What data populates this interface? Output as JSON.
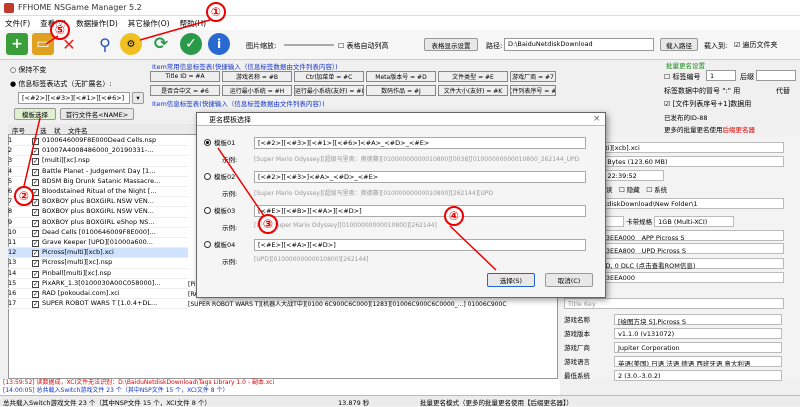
{
  "title": "FFHOME NSGame Manager 5.2",
  "menu": [
    "文件(F)",
    "查看(V)",
    "数据操作(D)",
    "其它操作(O)",
    "帮助(H)"
  ],
  "toolbar": {
    "thumb_label": "图片缩放:",
    "auto_table": "表格自动列高",
    "table_btn": "表格显示设置",
    "path_label": "路径:",
    "path_value": "D:\\BaiduNetdiskDownload",
    "load_path": "载入路径",
    "load_into": "载入到:",
    "filelist": "遍历文件夹"
  },
  "rename": {
    "keep": "保持不变",
    "template_label": "信息标签表达式（无扩展名）:",
    "template_value": "[<#2>][<#3>][<#1>][<#6>]",
    "template_btn": "模板选择",
    "first_file": "首行文件名<NAME>",
    "hint1": "Item常用信息标签表(快捷输入（信息标签数据由文件列表内容）)",
    "hint2": "Item信息标签表(快捷输入（信息标签数据由文件列表内容）)"
  },
  "tags": [
    "Title ID = #A",
    "游戏名称 = #B",
    "Ctrl加菜单 = #C",
    "Meta版本号 = #D",
    "文件类型 = #E",
    "游戏厂商 = #7",
    "是否合中文 = #6",
    "运行最小系统 = #H",
    "运行最小系统(友好) = #I",
    "数码作品 = #J",
    "文件大小(友好) = #K",
    "文件列表序号 = #L"
  ],
  "batch": {
    "title": "批量更名设置",
    "mark": "标签编号",
    "start": "1",
    "after": "后缀",
    "suffix_label": "标签数据中的冒号 \":\" 用",
    "suffix_val": "代替",
    "keep_sn": "[文件列表序号+1]数据用",
    "hint": "更名的修改文件名",
    "publish": "已发布的ID-88",
    "more": "更多的批量更名使用",
    "more_link": "后缀更名器"
  },
  "columns": [
    "序号",
    "选",
    "状",
    "文件名"
  ],
  "rows": [
    {
      "n": "1",
      "name": "0100646009F8E000Dead Cells.nsp",
      "r": ""
    },
    {
      "n": "2",
      "name": "01007A4008486000_20190331-...",
      "r": ""
    },
    {
      "n": "3",
      "name": "[multi][xc].nsp",
      "r": ""
    },
    {
      "n": "4",
      "name": "Battle Planet - Judgement Day [1...",
      "r": ""
    },
    {
      "n": "5",
      "name": "BDSM Big Drunk Satanic Massacre...",
      "r": ""
    },
    {
      "n": "6",
      "name": "Bloodstained Ritual of the Night [...",
      "r": ""
    },
    {
      "n": "7",
      "name": "BOXBOY plus BOXGIRL NSW VEN...",
      "r": ""
    },
    {
      "n": "8",
      "name": "BOXBOY plus BOXGIRL NSW VEN...",
      "r": ""
    },
    {
      "n": "9",
      "name": "BOXBOY plus BOXGIRL eShop NS...",
      "r": ""
    },
    {
      "n": "10",
      "name": "Dead Cells [0100646009F8E000]...",
      "r": ""
    },
    {
      "n": "11",
      "name": "Grave Keeper [UPD][01000a600...",
      "r": ""
    },
    {
      "n": "12",
      "name": "Picross[multi][xcb].xci",
      "r": ""
    },
    {
      "n": "13",
      "name": "Picross[multi][xc].nsp",
      "r": ""
    },
    {
      "n": "14",
      "name": "Pinball[multi][xc].nsp",
      "r": ""
    },
    {
      "n": "15",
      "name": "PixARK_1.3[0100030A00C058000]...",
      "r": "[PixARK][方块方舟][0100030A00C058000][1417][0100030A00C058000_65536_XCI].xci      010030A00C"
    },
    {
      "n": "16",
      "name": "RAD [pokoudai.com].xci",
      "r": "[RAD][无世突变][0100244005C16000][0][0100244000C516000_0_XCI].xci                 010024400C"
    },
    {
      "n": "17",
      "name": "SUPER ROBOT WARS T [1.0.4+DL...",
      "r": "[SUPER ROBOT WARS T][机器人大战T中][0100 6C900C6C000][1283][01006C900C6C0000_...]  01006C900C"
    }
  ],
  "info": {
    "name": "Picross[multi][xcb].xci",
    "size": "29,602,566 Bytes (123.60 MB)",
    "date": "2019/10/08 22:39:52",
    "attr_save": "存档",
    "attr_ro": "只读",
    "attr_hidden": "隐藏",
    "attr_sys": "系统",
    "path": "D:\\BaiduNetdiskDownload\\New Folder\\1",
    "type": "XCI",
    "card": "卡带规格",
    "card_val": "1GB (Multi-XCI)",
    "id1": "0100BA0003EEA000",
    "app1": "APP Picross S",
    "id2": "0100BA0003EEA800",
    "app2": "UPD Picross S",
    "count": "1 APP, 1 UPD, 0 DLC (点击查看ROM信息)",
    "tid": "0100BA0003EEA000",
    "title_key": "Title Key",
    "gname_label": "游戏名称",
    "gname": "[绘图方块 S].Picross S",
    "ver_label": "游戏版本",
    "ver": "v1.1.0 (v131072)",
    "maker_label": "游戏厂商",
    "maker": "Jupiter Corporation",
    "lang_label": "游戏语言",
    "lang": "英语(美国) 日语 法语 德语 西班牙语 意大利语",
    "sys_label": "最低系统",
    "sys": "2 (3.0.-3.0.2)"
  },
  "dialog": {
    "title": "更名模板选择",
    "templates": [
      {
        "label": "模板01",
        "value": "[<#2>][<#3>][<#1>][<#6>]<#A>_<#D>_<#E>",
        "example": "[Super Mario Odyssey][超级马里奥：奥德赛][01000000000010800][0038][01000000000010800_262144_UPD"
      },
      {
        "label": "模板02",
        "value": "[<#2>][<#3>]<#A>_<#D>_<#E>",
        "example": "[Super Mario Odyssey][超级马里奥：奥德赛][01000000000010800][262144][UPD"
      },
      {
        "label": "模板03",
        "value": "[<#E>][<#B>][<#A>][<#D>]",
        "example": "[UPD][Super Mario Odyssey][01000000000010800][262144]"
      },
      {
        "label": "模板04",
        "value": "[<#E>][<#A>][<#D>]",
        "example": "[UPD][01000000000010800][262144]"
      }
    ],
    "example_label": "示例:",
    "select": "选择(S)",
    "cancel": "取消(C)"
  },
  "log": [
    "[13:59:52] 读数据成，XCI文件无法识别：D:\\BaiduNetdiskDownload\\Tags Library 1.0 - 副本.xci",
    "[14:00:05] 总共载入Switch游戏文件 23 个（其中NSP文件 15 个，XCI文件 8 个）"
  ],
  "status": {
    "left": "总共载入Switch游戏文件 23 个（其中NSP文件 15 个，XCI文件 8 个）",
    "time": "13.879 秒",
    "right": "批量更名模式（更多的批量更名使用【后缀更名器】）"
  },
  "annotations": [
    "①",
    "②",
    "③",
    "④",
    "⑤"
  ]
}
